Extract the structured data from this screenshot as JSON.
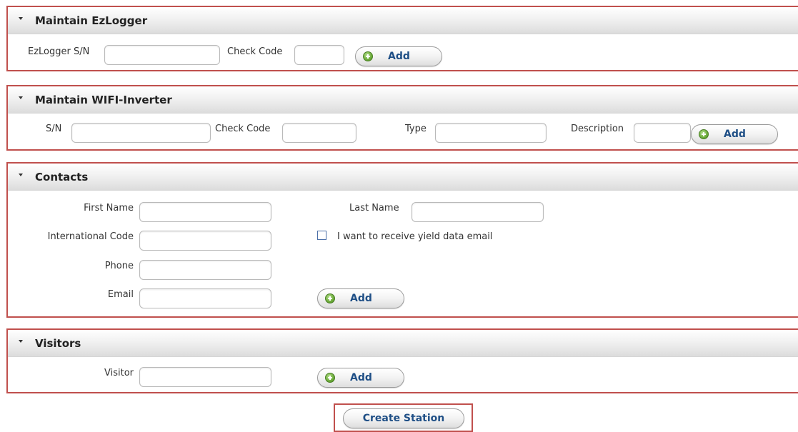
{
  "ezlogger": {
    "title": "Maintain EzLogger",
    "sn_label": "EzLogger S/N",
    "sn_value": "",
    "check_label": "Check Code",
    "check_value": "",
    "add_label": "Add"
  },
  "wifi": {
    "title": "Maintain WIFI-Inverter",
    "sn_label": "S/N",
    "sn_value": "",
    "check_label": "Check Code",
    "check_value": "",
    "type_label": "Type",
    "type_value": "",
    "desc_label": "Description",
    "desc_value": "",
    "add_label": "Add"
  },
  "contacts": {
    "title": "Contacts",
    "first_name_label": "First Name",
    "first_name_value": "",
    "last_name_label": "Last Name",
    "last_name_value": "",
    "intl_code_label": "International Code",
    "intl_code_value": "",
    "yield_email_label": "I want to receive yield data email",
    "yield_email_checked": false,
    "phone_label": "Phone",
    "phone_value": "",
    "email_label": "Email",
    "email_value": "",
    "add_label": "Add"
  },
  "visitors": {
    "title": "Visitors",
    "visitor_label": "Visitor",
    "visitor_value": "",
    "add_label": "Add"
  },
  "create_station_label": "Create Station",
  "icons": {
    "collapse": "caret-down-icon",
    "add": "plus-circle-icon"
  },
  "colors": {
    "panel_border": "#c0504d",
    "button_text": "#1f4f86",
    "add_icon": "#6cab3a"
  }
}
